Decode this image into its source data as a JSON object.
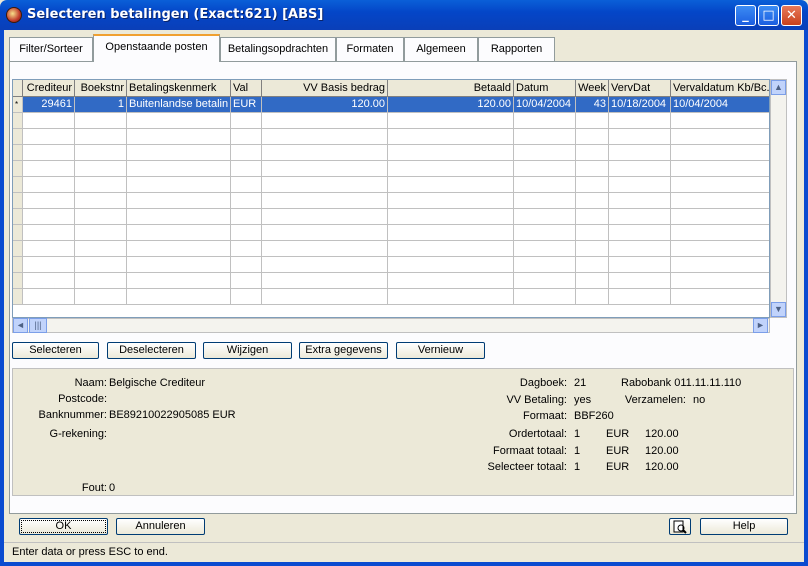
{
  "window": {
    "title": "Selecteren betalingen (Exact:621) [ABS]"
  },
  "tabs": [
    "Filter/Sorteer",
    "Openstaande posten",
    "Betalingsopdrachten",
    "Formaten",
    "Algemeen",
    "Rapporten"
  ],
  "active_tab": "Openstaande posten",
  "table": {
    "columns": [
      "Crediteur",
      "Boekstnr",
      "Betalingskenmerk",
      "Val",
      "VV Basis bedrag",
      "Betaald",
      "Datum",
      "Week",
      "VervDat",
      "Vervaldatum Kb/Bc."
    ],
    "row_marker": "*",
    "rows": [
      [
        "29461",
        "1",
        "Buitenlandse betalin",
        "EUR",
        "120.00",
        "120.00",
        "10/04/2004",
        "43",
        "10/18/2004",
        "10/04/2004"
      ]
    ]
  },
  "actions": {
    "select": "Selecteren",
    "deselect": "Deselecteren",
    "modify": "Wijzigen",
    "extra": "Extra gegevens",
    "refresh": "Vernieuw"
  },
  "details": {
    "naam_label": "Naam:",
    "naam_value": "Belgische Crediteur",
    "postcode_label": "Postcode:",
    "postcode_value": "",
    "bank_label": "Banknummer:",
    "bank_value": "BE89210022905085 EUR",
    "grek_label": "G-rekening:",
    "grek_value": "",
    "fout_label": "Fout:",
    "fout_value": "0",
    "dagboek_label": "Dagboek:",
    "dagboek_value": "21",
    "bank_name": "Rabobank 011.11.11.110",
    "vvbet_label": "VV Betaling:",
    "vvbet_value": "yes",
    "verz_label": "Verzamelen:",
    "verz_value": "no",
    "formaat_label": "Formaat:",
    "formaat_value": "BBF260",
    "totals": [
      {
        "label": "Ordertotaal:",
        "count": "1",
        "currency": "EUR",
        "amount": "120.00"
      },
      {
        "label": "Formaat totaal:",
        "count": "1",
        "currency": "EUR",
        "amount": "120.00"
      },
      {
        "label": "Selecteer totaal:",
        "count": "1",
        "currency": "EUR",
        "amount": "120.00"
      }
    ]
  },
  "bottom_buttons": {
    "ok": "OK",
    "cancel": "Annuleren",
    "help": "Help"
  },
  "status": "Enter data or press ESC to end.",
  "colors": {
    "title_bar": "#0a4bd0",
    "selection": "#316ac5",
    "active_tab_accent": "#f0a030"
  }
}
